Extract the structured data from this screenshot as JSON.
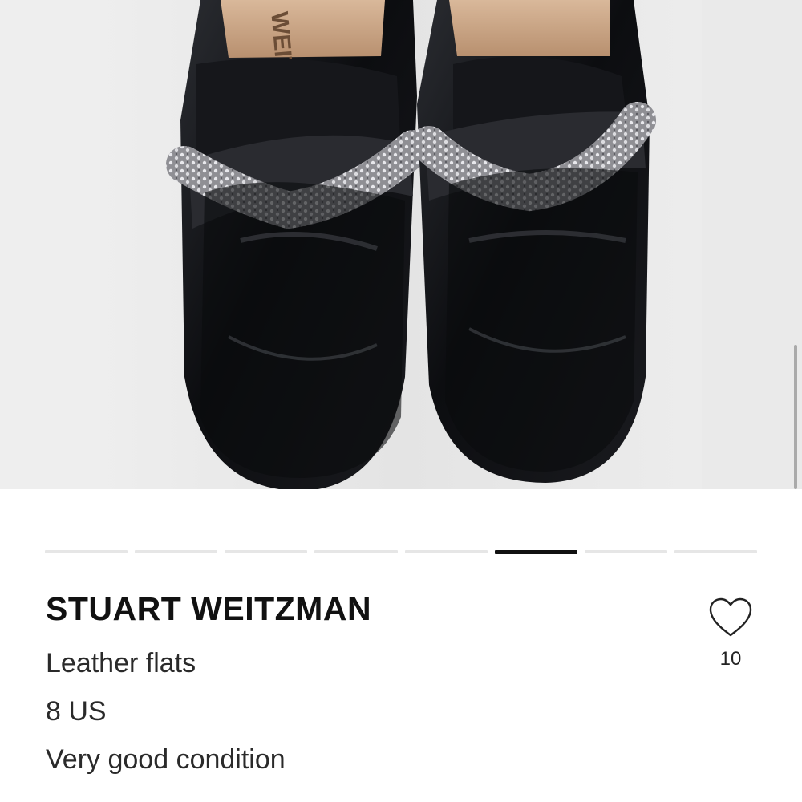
{
  "listing": {
    "image": {
      "subject": "black leather loafers with braided crystal chain strap",
      "insole_brand_text": "WEITZMAN",
      "current_index": 5,
      "total_images": 8
    },
    "pager": {
      "segments": [
        {
          "active": false
        },
        {
          "active": false
        },
        {
          "active": false
        },
        {
          "active": false
        },
        {
          "active": false
        },
        {
          "active": true
        },
        {
          "active": false
        },
        {
          "active": false
        }
      ]
    },
    "brand": "STUART WEITZMAN",
    "title": "Leather flats",
    "size": "8 US",
    "condition": "Very good condition",
    "like": {
      "icon": "heart-outline-icon",
      "count": "10"
    }
  },
  "colors": {
    "accent": "#111111",
    "pager_inactive": "#e6e6e6",
    "text_secondary": "#2a2a2a",
    "photo_background": "#ececec",
    "leather": "#0e0f12",
    "strap_metal": "#b9b9bd"
  }
}
